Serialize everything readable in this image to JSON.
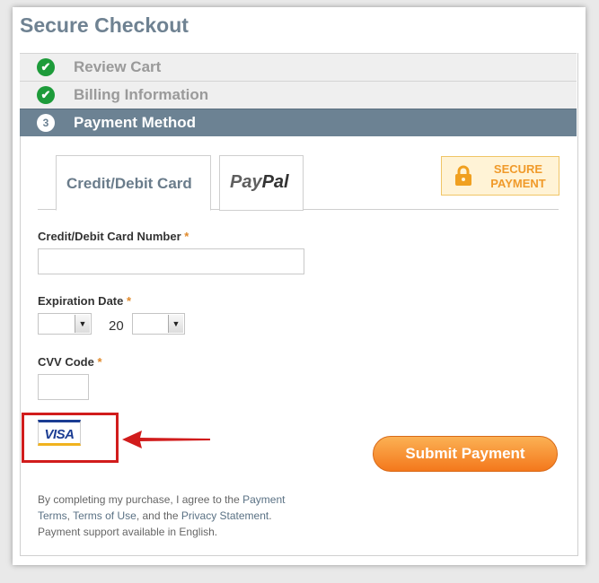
{
  "page": {
    "title": "Secure Checkout"
  },
  "steps": [
    {
      "badge": "✔",
      "label": "Review Cart"
    },
    {
      "badge": "✔",
      "label": "Billing Information"
    },
    {
      "badge": "3",
      "label": "Payment Method"
    }
  ],
  "tabs": {
    "card": "Credit/Debit Card",
    "paypal_a": "Pay",
    "paypal_b": "Pal"
  },
  "secure_badge": {
    "line1": "SECURE",
    "line2": "PAYMENT"
  },
  "form": {
    "card_number_label": "Credit/Debit Card Number",
    "expiration_label": "Expiration Date",
    "year_prefix": "20",
    "cvv_label": "CVV Code",
    "required_mark": "*"
  },
  "card_brand": "VISA",
  "submit_label": "Submit Payment",
  "legal": {
    "t1": "By completing my purchase, I agree to the ",
    "link1": "Payment Terms",
    "t2": ", ",
    "link2": "Terms of Use",
    "t3": ", and the ",
    "link3": "Privacy Statement",
    "t4": ".",
    "support": "Payment support available in English."
  },
  "colors": {
    "accent": "#6c8293",
    "submit": "#f4781c",
    "check": "#1d9b3a",
    "highlight": "#d11c1c"
  }
}
